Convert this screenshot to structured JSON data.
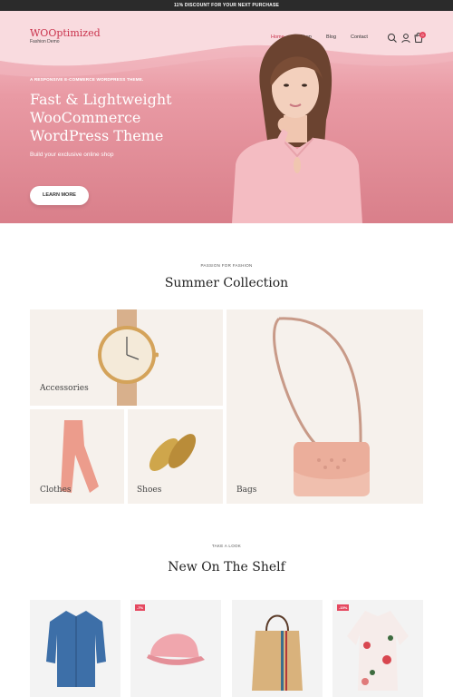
{
  "topbar": {
    "text": "11% DISCOUNT FOR YOUR NEXT PURCHASE"
  },
  "header": {
    "logo": "WOOptimized",
    "logo_sub": "Fashion Demo",
    "nav": [
      "Home",
      "Shop",
      "Blog",
      "Contact"
    ],
    "cart_count": "0"
  },
  "hero": {
    "kicker": "A RESPONSIVE E-COMMERCE WORDPRESS THEME.",
    "title_lines": [
      "Fast & Lightweight",
      "WooCommerce",
      "WordPress Theme"
    ],
    "subtitle": "Build your exclusive online shop",
    "button": "LEARN MORE"
  },
  "collection": {
    "kicker": "PASSION FOR FASHION",
    "title": "Summer Collection",
    "tiles": [
      "Accessories",
      "Bags",
      "Clothes",
      "Shoes"
    ]
  },
  "shelf": {
    "kicker": "TAKE A LOOK",
    "title": "New On The Shelf",
    "badges": [
      "-7%",
      "-15%"
    ]
  },
  "colors": {
    "accent": "#c9324c",
    "hero_bg": "#e99aa4",
    "sale": "#e5485f",
    "topbar": "#2b2b2b"
  }
}
